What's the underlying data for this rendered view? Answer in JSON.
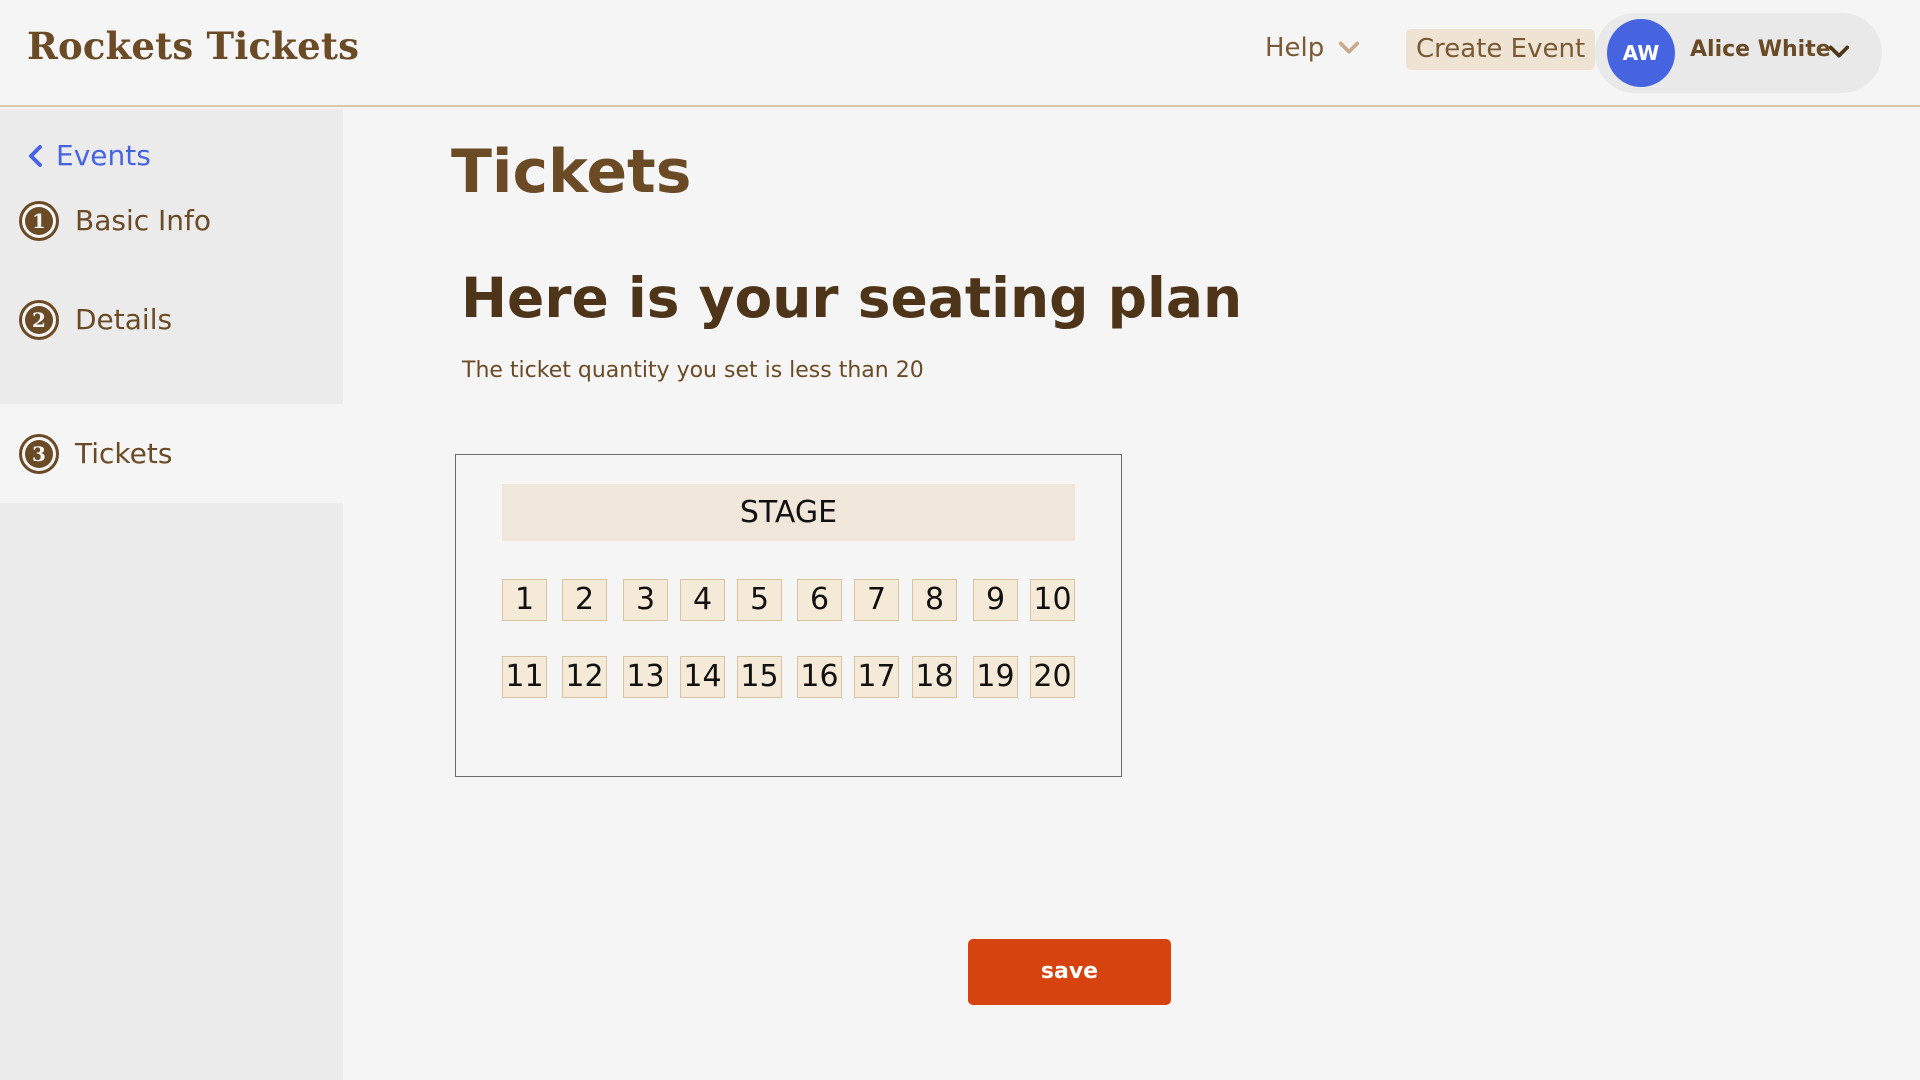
{
  "header": {
    "brand": "Rockets Tickets",
    "help_label": "Help",
    "create_event_label": "Create Event",
    "user": {
      "initials": "AW",
      "name": "Alice White"
    }
  },
  "sidebar": {
    "back_label": "Events",
    "steps": [
      {
        "number": "1",
        "label": "Basic Info"
      },
      {
        "number": "2",
        "label": "Details"
      },
      {
        "number": "3",
        "label": "Tickets"
      }
    ],
    "active_step": "Tickets"
  },
  "main": {
    "page_title": "Tickets",
    "section_title": "Here is your seating plan",
    "subtitle": "The ticket quantity you set is less than 20",
    "stage_label": "STAGE",
    "seats": [
      "1",
      "2",
      "3",
      "4",
      "5",
      "6",
      "7",
      "8",
      "9",
      "10",
      "11",
      "12",
      "13",
      "14",
      "15",
      "16",
      "17",
      "18",
      "19",
      "20"
    ],
    "save_label": "save"
  },
  "colors": {
    "brand_brown": "#6b4a26",
    "link_blue": "#4664e0",
    "save_orange": "#d6430e",
    "seat_fill": "#f5ead8"
  }
}
